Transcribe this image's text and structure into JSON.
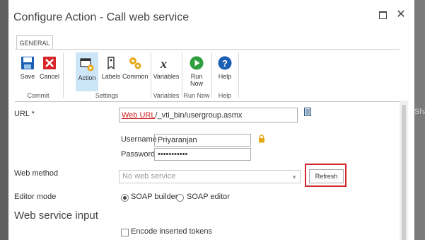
{
  "dialog": {
    "title": "Configure Action - Call web service",
    "maximize_icon": "maximize-icon",
    "close_icon": "close-icon"
  },
  "background": {
    "right_text": "Shar"
  },
  "ribbon": {
    "tab_label": "GENERAL",
    "groups": [
      {
        "label": "Commit",
        "buttons": [
          {
            "label": "Save",
            "icon": "save-icon"
          },
          {
            "label": "Cancel",
            "icon": "cancel-icon"
          }
        ]
      },
      {
        "label": "Settings",
        "buttons": [
          {
            "label": "Action",
            "icon": "action-icon",
            "active": true
          },
          {
            "label": "Labels",
            "icon": "labels-icon"
          },
          {
            "label": "Common",
            "icon": "common-icon"
          }
        ]
      },
      {
        "label": "Variables",
        "buttons": [
          {
            "label": "Variables",
            "icon": "variables-icon"
          }
        ]
      },
      {
        "label": "Run Now",
        "buttons": [
          {
            "label": "Run Now",
            "icon": "run-now-icon"
          }
        ]
      },
      {
        "label": "Help",
        "buttons": [
          {
            "label": "Help",
            "icon": "help-icon"
          }
        ]
      }
    ]
  },
  "form": {
    "url": {
      "label": "URL *",
      "link_text": "Web URL",
      "suffix": "/_vti_bin/usergroup.asmx",
      "icon": "insert-reference-icon"
    },
    "username": {
      "label": "Username",
      "value": "Priyaranjan",
      "icon": "lock-icon"
    },
    "password": {
      "label": "Password",
      "value": "•••••••••••"
    },
    "web_method": {
      "label": "Web method",
      "placeholder": "No web service",
      "refresh_label": "Refresh"
    },
    "editor_mode": {
      "label": "Editor mode",
      "options": [
        "SOAP builder",
        "SOAP editor"
      ],
      "selected": "SOAP builder"
    },
    "section_title": "Web service input",
    "encode_label": "Encode inserted tokens"
  },
  "colors": {
    "highlight": "#d0262c",
    "active_button": "#cde6f7",
    "link": "#cc1f1f"
  }
}
